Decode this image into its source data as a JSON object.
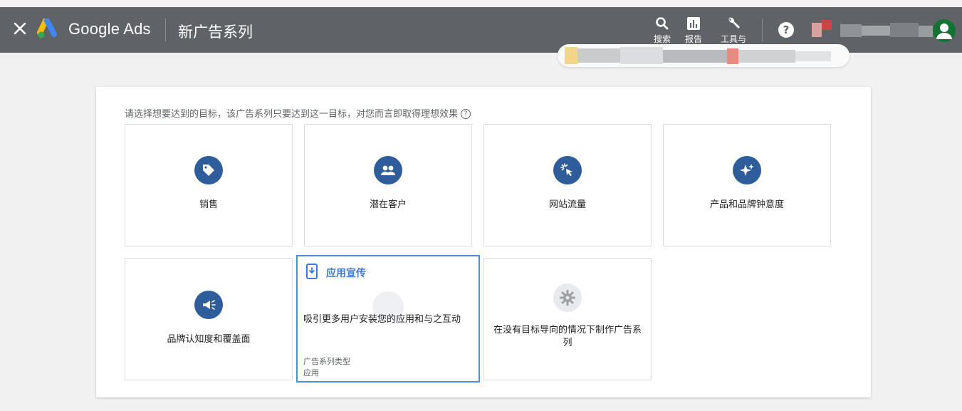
{
  "topbar": {
    "brand": "Google Ads",
    "title": "新广告系列",
    "tools": [
      {
        "label": "搜索",
        "icon": "search-icon"
      },
      {
        "label": "报告",
        "icon": "reports-icon"
      },
      {
        "label": "工具与",
        "icon": "wrench-icon"
      }
    ],
    "help": "?"
  },
  "main": {
    "instruction": "请选择想要达到的目标，该广告系列只要达到这一目标，对您而言即取得理想效果",
    "help_glyph": "?",
    "goals": [
      {
        "label": "销售",
        "icon": "tag-icon"
      },
      {
        "label": "潜在客户",
        "icon": "people-icon"
      },
      {
        "label": "网站流量",
        "icon": "cursor-click-icon"
      },
      {
        "label": "产品和品牌钟意度",
        "icon": "sparkle-icon"
      },
      {
        "label": "品牌认知度和覆盖面",
        "icon": "megaphone-icon"
      }
    ],
    "selected": {
      "title": "应用宣传",
      "description": "吸引更多用户安装您的应用和与之互动",
      "type_label": "广告系列类型",
      "type_value": "应用",
      "icon": "phone-download-icon"
    },
    "no_goal": {
      "label": "在没有目标导向的情况下制作广告系列",
      "icon": "gear-icon"
    }
  },
  "colors": {
    "topbar": "#5f6368",
    "icon_blue": "#2f5d9c",
    "selected_border": "#4a90d9"
  }
}
